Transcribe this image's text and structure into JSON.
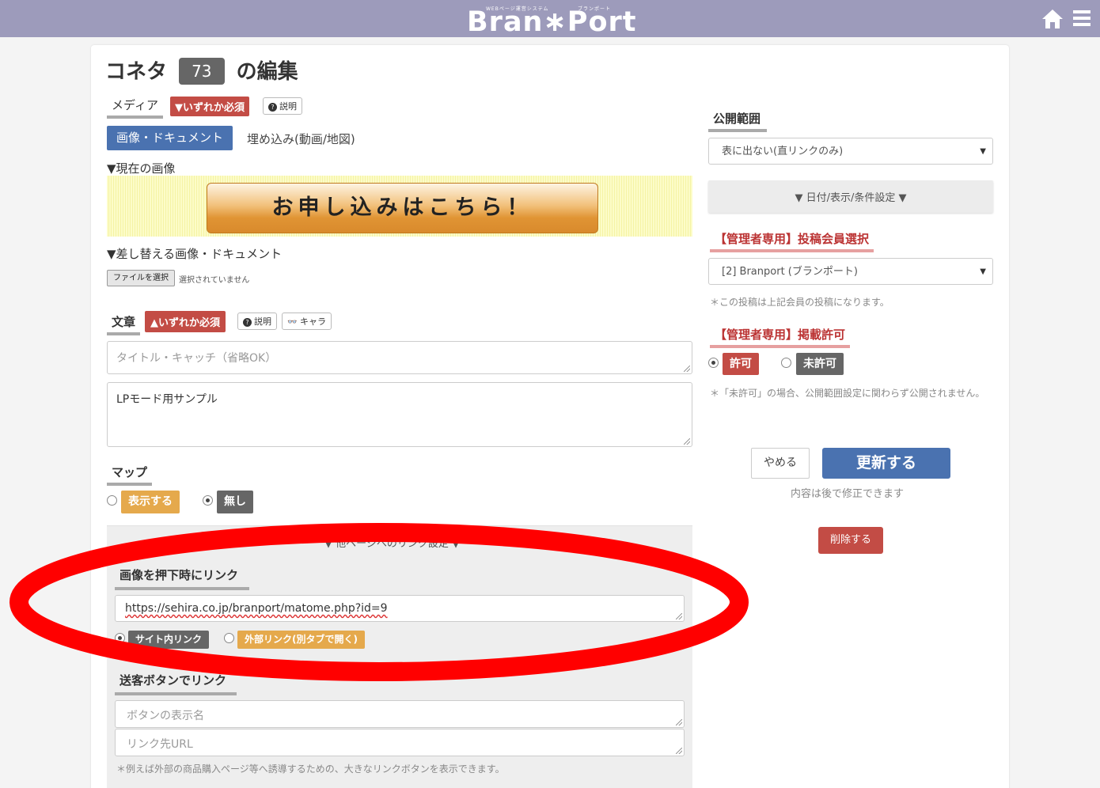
{
  "header": {
    "logo_small_left": "WEBページ運営システム",
    "logo_small_right": "ブランポート",
    "logo_name": "Bran∗Port",
    "home_icon": "home-icon",
    "menu_icon": "hamburger-menu-icon",
    "bar_color": "#9d9bbb"
  },
  "title": {
    "prefix": "コネタ",
    "number": "73",
    "suffix": "の編集"
  },
  "media": {
    "label": "メディア",
    "required": "▼いずれか必須",
    "help": "説明",
    "tab_active": "画像・ドキュメント",
    "tab_other": "埋め込み(動画/地図)",
    "current_image_label": "▼現在の画像",
    "banner_text": "お申し込みはこちら！",
    "replace_label": "▼差し替える画像・ドキュメント",
    "file_button": "ファイルを選択",
    "file_status": "選択されていません"
  },
  "text_section": {
    "label": "文章",
    "required": "▲いずれか必須",
    "help": "説明",
    "chara": "キャラ",
    "title_placeholder": "タイトル・キャッチ（省略OK）",
    "body_value": "LPモード用サンプル"
  },
  "map": {
    "label": "マップ",
    "option_show": "表示する",
    "option_none": "無し"
  },
  "link_panel": {
    "toggle": "▼ 他ページへのリンク設定 ▼",
    "image_link_label": "画像を押下時にリンク",
    "image_link_value": "https://sehira.co.jp/branport/matome.php?id=9",
    "option_internal": "サイト内リンク",
    "option_external": "外部リンク(別タブで開く)",
    "send_button_label": "送客ボタンでリンク",
    "button_name_placeholder": "ボタンの表示名",
    "link_url_placeholder": "リンク先URL",
    "note": "＊例えば外部の商品購入ページ等へ誘導するための、大きなリンクボタンを表示できます。"
  },
  "sidebar": {
    "visibility_label": "公開範囲",
    "visibility_value": "表に出ない(直リンクのみ)",
    "conditions_toggle": "▼ 日付/表示/条件設定 ▼",
    "member_label": "【管理者専用】投稿会員選択",
    "member_value": "[2] Branport (ブランポート)",
    "member_note": "＊この投稿は上記会員の投稿になります。",
    "permission_label": "【管理者専用】掲載許可",
    "option_allow": "許可",
    "option_deny": "未許可",
    "permission_note": "＊「未許可」の場合、公開範囲設定に関わらず公開されません。",
    "cancel": "やめる",
    "update": "更新する",
    "update_note": "内容は後で修正できます",
    "delete": "削除する"
  },
  "colors": {
    "accent_blue": "#4a72b0",
    "required_red": "#c34c45",
    "option_orange": "#e5a94c",
    "annotation_red": "#ff0000"
  }
}
